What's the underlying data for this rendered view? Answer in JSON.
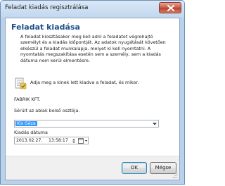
{
  "window": {
    "title": "Feladat kiadás regisztrálása",
    "close_icon": "close-icon"
  },
  "main": {
    "heading": "Feladat kiadása",
    "description_lines": [
      "A feladat kiosztásakor meg kell adni a feladatot végrehajtó",
      "személyt és a kiadás időpontját. Az adatok nyugátását követően",
      "elkészül a feladat munkalapja, melyet ki kell nyomtatni. A",
      "nyomtatás megszakítása esetén sem a személy, sem a kiadás",
      "dátuma nem kerül elmentésre."
    ],
    "form_icon": "form-icon",
    "prompt": "Adja meg a kinek lett kiadva a feladat, és mikor.",
    "company": "FABRIK KFT.",
    "injured_label": "Sérült az ablak belső osztója.",
    "person_select": {
      "selected": "Kis Géza"
    },
    "date_label": "Kiadás dátuma",
    "date_value": "2013.02.27.",
    "time_value": "13:58:17"
  },
  "footer": {
    "ok_label": "OK",
    "cancel_label": "Mégse"
  },
  "colors": {
    "heading": "#1e4f8c",
    "selection": "#3399ff",
    "frame": "#b9d1ea"
  }
}
